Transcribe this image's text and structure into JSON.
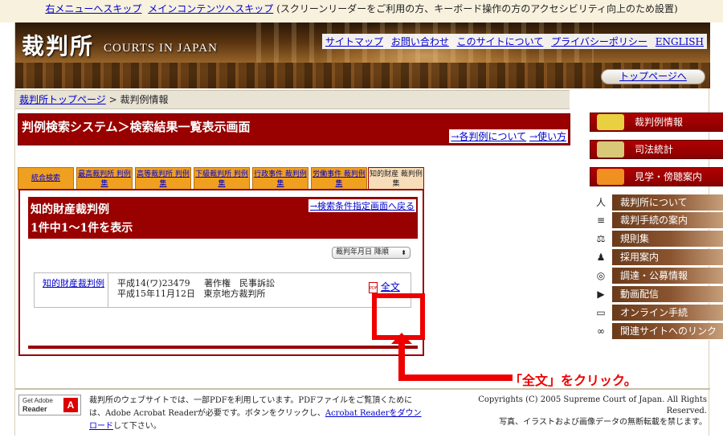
{
  "skip": {
    "right_menu": "右メニューへスキップ",
    "main_content": "メインコンテンツへスキップ",
    "note": "(スクリーンリーダーをご利用の方、キーボード操作の方のアクセシビリティ向上のため設置)"
  },
  "header": {
    "logo_jp": "裁判所",
    "logo_en": "COURTS IN JAPAN",
    "links": [
      "サイトマップ",
      "お問い合わせ",
      "このサイトについて",
      "プライバシーポリシー",
      "ENGLISH"
    ],
    "top_page": "トップページへ"
  },
  "breadcrumb": {
    "home": "裁判所トップページ",
    "separator": ">",
    "current": "裁判例情報"
  },
  "title_bar": {
    "title": "判例検索システム＞検索結果一覧表示画面",
    "link_about": "→各判例について",
    "link_howto": "→使い方"
  },
  "tabs": [
    {
      "label": "統合検索",
      "active": false
    },
    {
      "label": "最高裁判所 判例集",
      "active": false
    },
    {
      "label": "高等裁判所 判例集",
      "active": false
    },
    {
      "label": "下級裁判所 判例集",
      "active": false
    },
    {
      "label": "行政事件 裁判例集",
      "active": false
    },
    {
      "label": "労働事件 裁判例集",
      "active": false
    },
    {
      "label": "知的財産 裁判例集",
      "active": true
    }
  ],
  "results": {
    "heading": "知的財産裁判例",
    "count_text": "1件中1〜1件を表示",
    "back_link": "→検索条件指定画面へ戻る",
    "sort_label": "裁判年月日 降順",
    "rows": [
      {
        "type": "知的財産裁判例",
        "case_no": "平成14(ワ)23479",
        "category": "著作権　民事訴訟",
        "date": "平成15年11月12日",
        "court": "東京地方裁判所",
        "fulltext": "全文",
        "pdf_icon": "PDF"
      }
    ]
  },
  "callout": {
    "text": "「全文」をクリック。",
    "color": "#ee0000"
  },
  "sidebar": {
    "main": [
      {
        "label": "裁判例情報",
        "icon": "pencil-icon"
      },
      {
        "label": "司法統計",
        "icon": "bar-chart-icon"
      },
      {
        "label": "見学・傍聴案内",
        "icon": "building-icon"
      }
    ],
    "sub": [
      {
        "label": "裁判所について",
        "icon": "person-icon",
        "glyph": "人"
      },
      {
        "label": "裁判手続の案内",
        "icon": "document-icon",
        "glyph": "≡"
      },
      {
        "label": "規則集",
        "icon": "gavel-icon",
        "glyph": "⚖"
      },
      {
        "label": "採用案内",
        "icon": "recruit-icon",
        "glyph": "♟"
      },
      {
        "label": "調達・公募情報",
        "icon": "globe-icon",
        "glyph": "◎"
      },
      {
        "label": "動画配信",
        "icon": "play-icon",
        "glyph": "▶"
      },
      {
        "label": "オンライン手続",
        "icon": "monitor-icon",
        "glyph": "▭"
      },
      {
        "label": "関連サイトへのリンク",
        "icon": "link-icon",
        "glyph": "∞"
      }
    ]
  },
  "footer": {
    "adobe_line1": "Get Adobe",
    "adobe_line2": "Reader",
    "text_before": "裁判所のウェブサイトでは、一部PDFを利用しています。PDFファイルをご覧頂くためには、Adobe Acrobat Readerが必要です。ボタンをクリックし、",
    "download_link": "Acrobat Readerをダウンロード",
    "text_after": "して下さい。",
    "copyright": "Copyrights (C) 2005 Supreme Court of Japan. All Rights Reserved.",
    "copyright2": "写真、イラストおよび画像データの無断転載を禁じます。"
  },
  "colors": {
    "brand_red": "#990000",
    "tab_orange": "#f0a020",
    "highlight": "#ee0000"
  }
}
